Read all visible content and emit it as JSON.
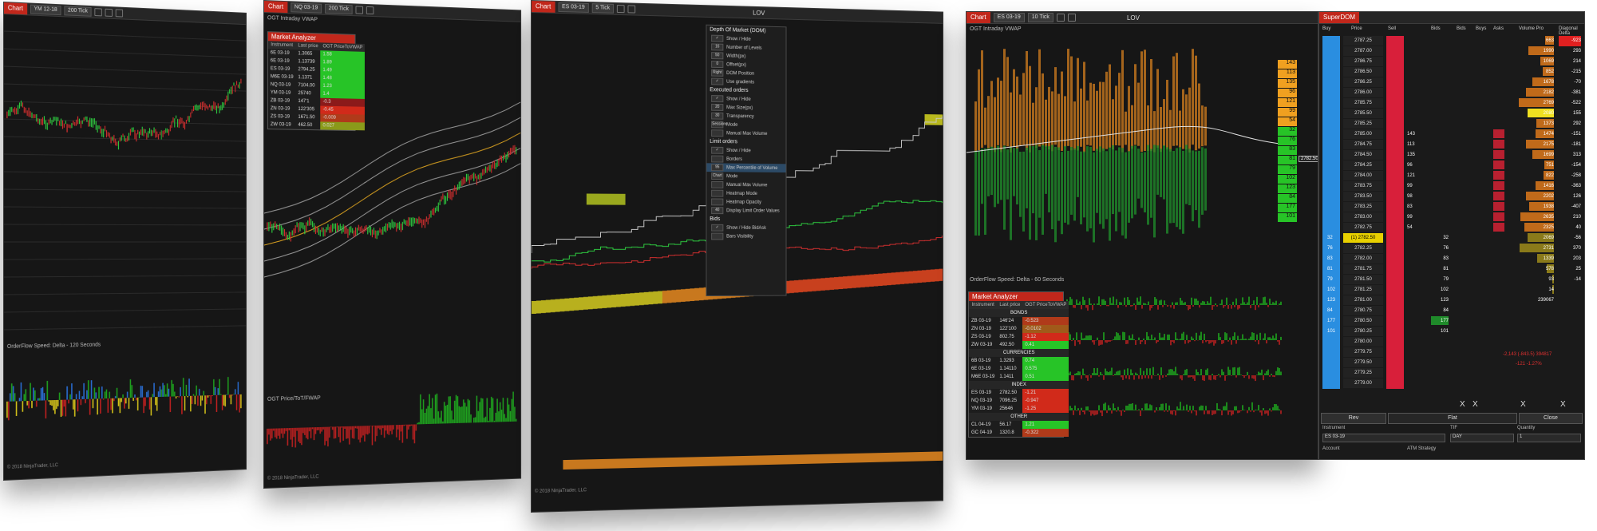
{
  "w1": {
    "chart_tab": "Chart",
    "instrument": "YM 12-18",
    "interval": "200 Tick",
    "panel_label": "OrderFlow Speed: Delta - 120 Seconds",
    "copyright": "© 2018 NinjaTrader, LLC"
  },
  "w2": {
    "chart_tab": "Chart",
    "instrument": "NQ 03-19",
    "interval": "200 Tick",
    "top_label": "OGT Intraday VWAP",
    "panel_label": "OGT Price/ToT/FWAP",
    "copyright": "© 2018 NinjaTrader, LLC",
    "analyzer": {
      "title": "Market Analyzer",
      "headers": [
        "Instrument",
        "Last price",
        "OGT PriceToVWAP"
      ],
      "rows": [
        [
          "6E 03-19",
          "1.3065",
          "1.58",
          "#27c427"
        ],
        [
          "6E 03-19",
          "1.13739",
          "1.89",
          "#27c427"
        ],
        [
          "ES 03-19",
          "2794.25",
          "1.49",
          "#27c427"
        ],
        [
          "M6E 03-19",
          "1.1371",
          "1.48",
          "#27c427"
        ],
        [
          "NQ 03-19",
          "7104.00",
          "1.23",
          "#27c427"
        ],
        [
          "YM 03-19",
          "25740",
          "1.4",
          "#27c427"
        ],
        [
          "ZB 03-19",
          "147'1",
          "-0.3",
          "#8b1a1a"
        ],
        [
          "ZN 03-19",
          "122'305",
          "-0.45",
          "#d12a1a"
        ],
        [
          "ZS 03-19",
          "1671.50",
          "-0.009",
          "#b03a1a"
        ],
        [
          "ZW 03-19",
          "462.50",
          "0.027",
          "#8a9a1a"
        ]
      ]
    }
  },
  "w3": {
    "chart_tab": "Chart",
    "instrument": "ES 03-19",
    "interval": "5 Tick",
    "indicator": "LOV",
    "copyright": "© 2018 NinjaTrader, LLC",
    "menu": {
      "title": "Depth Of Market (DOM)",
      "sec2": "Executed orders",
      "sec3": "Limit orders",
      "sec4": "Bids",
      "items1": [
        [
          "✓",
          "Show / Hide"
        ],
        [
          "16",
          "Number of Levels"
        ],
        [
          "50",
          "Width(px)"
        ],
        [
          "0",
          "Offset(px)"
        ],
        [
          "Right",
          "DOM Position"
        ],
        [
          "✓",
          "Use gradients"
        ]
      ],
      "items2": [
        [
          "✓",
          "Show / Hide"
        ],
        [
          "20",
          "Max Size(px)"
        ],
        [
          "30",
          "Transparency"
        ],
        [
          "Sessions",
          "Mode"
        ],
        [
          "",
          "Manual Max Volume"
        ]
      ],
      "items3": [
        [
          "✓",
          "Show / Hide"
        ],
        [
          "",
          "Borders"
        ],
        [
          "95",
          "Max Percentile of Volume"
        ],
        [
          "Chart",
          "Mode"
        ],
        [
          "",
          "Manual Max Volume"
        ],
        [
          "",
          "Heatmap Mode"
        ],
        [
          "",
          "Heatmap Opacity"
        ],
        [
          "40",
          "Display Limit Order Values"
        ]
      ],
      "items4": [
        [
          "✓",
          "Show / Hide BidAsk"
        ],
        [
          "",
          "Bars Visibility"
        ]
      ]
    }
  },
  "w4": {
    "chart_tab": "Chart",
    "instrument": "ES 03-19",
    "interval": "10 Tick",
    "indicator": "LOV",
    "top_label": "OGT Intraday VWAP",
    "panel_label": "OrderFlow Speed: Delta - 60 Seconds",
    "right_values": [
      "143",
      "113",
      "135",
      "96",
      "121",
      "99",
      "54",
      "32",
      "76",
      "83",
      "81",
      "79",
      "102",
      "123",
      "84",
      "177",
      "101"
    ],
    "right_colors": [
      "#f0a020",
      "#f0a020",
      "#f0a020",
      "#f0a020",
      "#f0a020",
      "#f0a020",
      "#f0a020",
      "#27c427",
      "#27c427",
      "#27c427",
      "#27c427",
      "#27c427",
      "#27c427",
      "#27c427",
      "#27c427",
      "#27c427",
      "#27c427"
    ],
    "price_box": "2782.50",
    "analyzer": {
      "title": "Market Analyzer",
      "headers": [
        "Instrument",
        "Last price",
        "OGT PriceToVWAP"
      ],
      "groups": [
        {
          "name": "BONDS",
          "rows": [
            [
              "ZB 03-19",
              "146'24",
              "-0.523",
              "#b03a1a"
            ],
            [
              "ZN 03-19",
              "122'100",
              "-0.0102",
              "#a05a1a"
            ],
            [
              "ZS 03-19",
              "802.75",
              "-1.12",
              "#d12a1a"
            ],
            [
              "ZW 03-19",
              "492.50",
              "0.41",
              "#27c427"
            ]
          ]
        },
        {
          "name": "CURRENCIES",
          "rows": [
            [
              "6B 03-19",
              "1.3293",
              "0.74",
              "#27c427"
            ],
            [
              "6E 03-19",
              "1.14110",
              "0.575",
              "#27c427"
            ],
            [
              "M6E 03-19",
              "1.1411",
              "0.51",
              "#27c427"
            ]
          ]
        },
        {
          "name": "INDEX",
          "rows": [
            [
              "ES 03-19",
              "2782.50",
              "-1.21",
              "#d12a1a"
            ],
            [
              "NQ 03-19",
              "7096.25",
              "-0.947",
              "#d12a1a"
            ],
            [
              "YM 03-19",
              "25646",
              "-1.25",
              "#d12a1a"
            ]
          ]
        },
        {
          "name": "OTHER",
          "rows": [
            [
              "CL 04-19",
              "56.17",
              "1.21",
              "#27c427"
            ],
            [
              "GC 04-19",
              "1320.8",
              "-0.322",
              "#b03a1a"
            ]
          ]
        }
      ]
    }
  },
  "superdom": {
    "title": "SuperDOM",
    "headers": [
      "Buy",
      "Price",
      "Sell",
      "Bids",
      "Bids",
      "Buys",
      "Asks",
      "Volume Pro",
      "Diagonal Delta"
    ],
    "prices": [
      "2787.25",
      "2787.00",
      "2786.75",
      "2786.50",
      "2786.25",
      "2786.00",
      "2785.75",
      "2785.50",
      "2785.25",
      "2785.00",
      "2784.75",
      "2784.50",
      "2784.25",
      "2784.00",
      "2783.75",
      "2783.50",
      "2783.25",
      "2783.00",
      "2782.75",
      "(1) 2782.50",
      "2782.25",
      "2782.00",
      "2781.75",
      "2781.50",
      "2781.25",
      "2781.00",
      "2780.75",
      "2780.50",
      "2780.25",
      "2780.00",
      "2779.75",
      "2779.50",
      "2779.25",
      "2779.00"
    ],
    "asks": [
      "",
      "",
      "",
      "",
      "",
      "",
      "",
      "",
      "",
      "143",
      "113",
      "135",
      "96",
      "121",
      "99",
      "98",
      "83",
      "99",
      "54",
      "",
      "",
      "",
      "",
      "",
      "",
      "",
      "",
      "",
      "",
      "",
      "",
      "",
      "",
      ""
    ],
    "bids": [
      "",
      "",
      "",
      "",
      "",
      "",
      "",
      "",
      "",
      "",
      "",
      "",
      "",
      "",
      "",
      "",
      "",
      "",
      "",
      "",
      "76",
      "83",
      "81",
      "79",
      "102",
      "123",
      "84",
      "177",
      "101",
      "",
      "",
      "",
      "",
      ""
    ],
    "buy_bids": [
      "",
      "",
      "",
      "",
      "",
      "",
      "",
      "",
      "",
      "",
      "",
      "",
      "",
      "",
      "",
      "",
      "",
      "",
      "",
      "32",
      "76",
      "83",
      "81",
      "79",
      "102",
      "123",
      "84",
      "177",
      "101",
      "",
      "",
      "",
      "",
      ""
    ],
    "volume": [
      "663",
      "1990",
      "1069",
      "852",
      "1678",
      "2182",
      "2769",
      "2080",
      "1373",
      "1474",
      "2175",
      "1699",
      "751",
      "822",
      "1416",
      "2202",
      "1938",
      "2635",
      "2325",
      "2069",
      "2731",
      "1339",
      "578",
      "93",
      "14",
      "239067",
      "",
      "",
      "",
      "",
      "",
      "",
      "",
      ""
    ],
    "delta": [
      "-923",
      "293",
      "214",
      "-215",
      "-70",
      "-381",
      "-522",
      "155",
      "292",
      "-151",
      "-181",
      "313",
      "-154",
      "-258",
      "-363",
      "126",
      "-407",
      "210",
      "40",
      "-56",
      "370",
      "203",
      "25",
      "-14",
      "",
      "",
      "",
      "",
      "",
      "",
      "",
      "",
      "",
      ""
    ],
    "summary1": "-2,143 (-843.5) 394817",
    "summary2": "-121 -1.27%",
    "btn_rev": "Rev",
    "btn_flat": "Flat",
    "btn_close": "Close",
    "instrument_label": "Instrument",
    "instrument_value": "ES 03-19",
    "tif_label": "TIF",
    "tif_value": "DAY",
    "qty_label": "Quantity",
    "qty_value": "1",
    "account_label": "Account",
    "atm_label": "ATM Strategy",
    "x": "X"
  }
}
